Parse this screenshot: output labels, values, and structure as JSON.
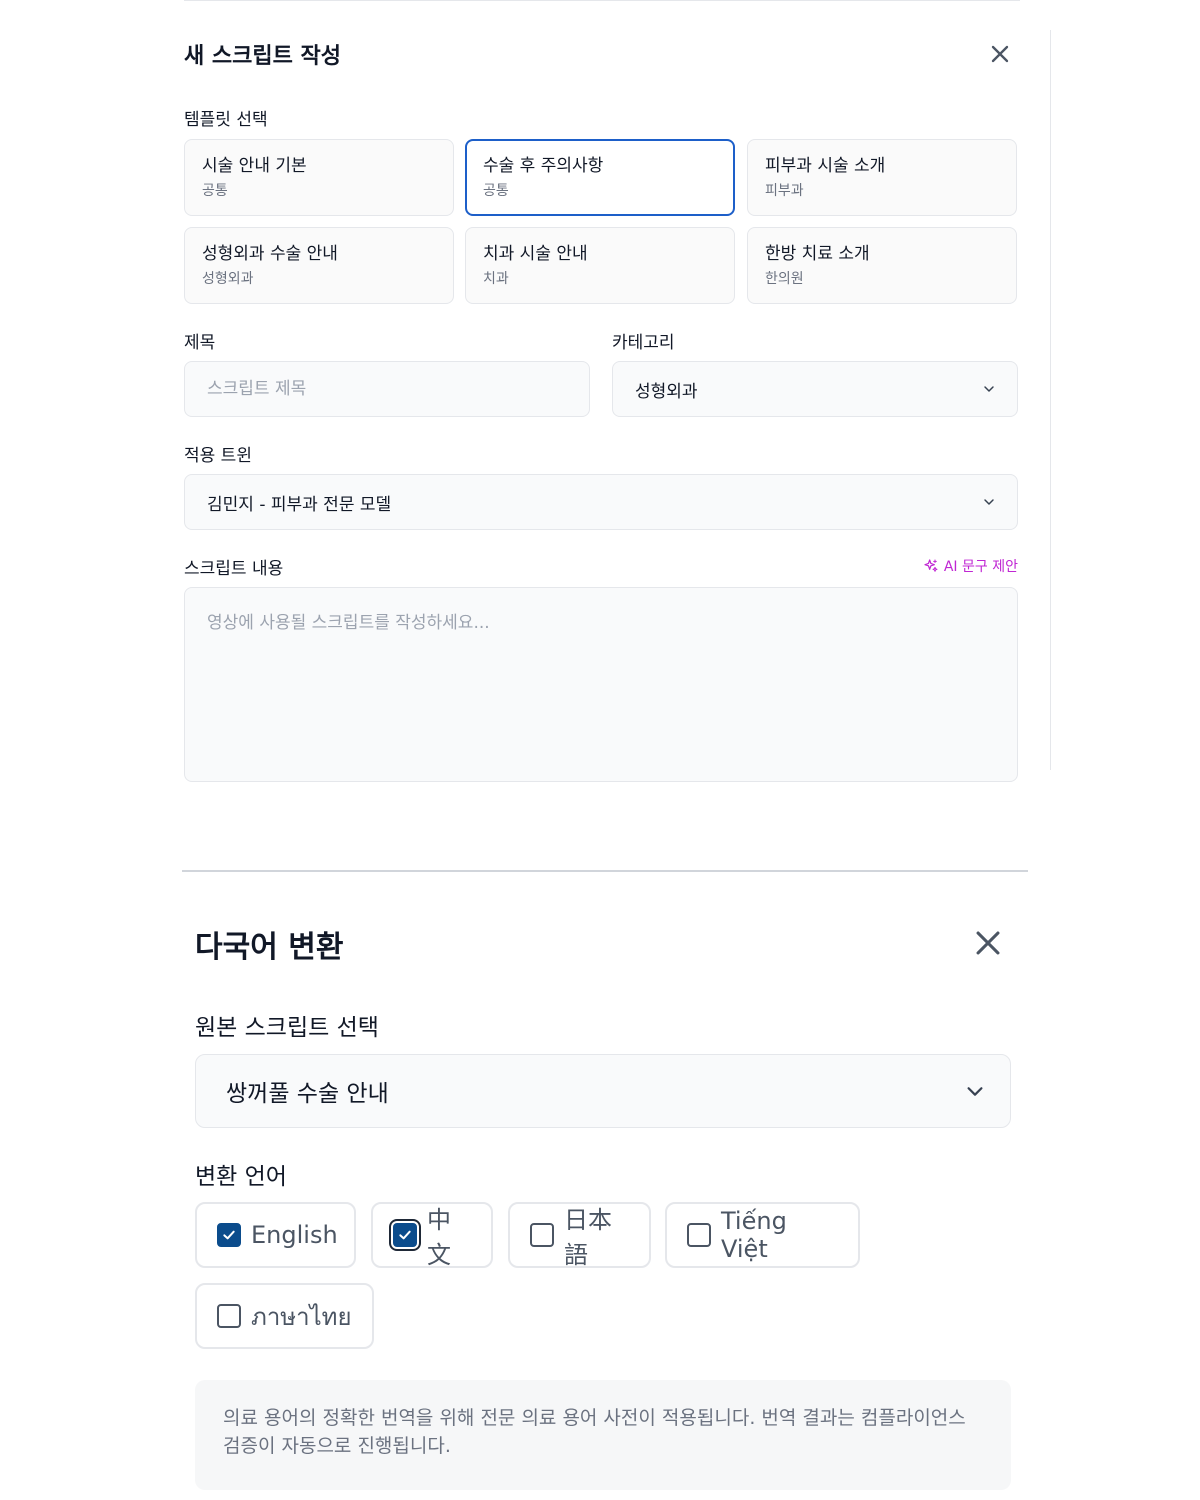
{
  "script_editor": {
    "title": "새 스크립트 작성",
    "close_icon": "close-icon",
    "template_label": "템플릿 선택",
    "templates": [
      {
        "name": "시술 안내 기본",
        "category": "공통",
        "selected": false
      },
      {
        "name": "수술 후 주의사항",
        "category": "공통",
        "selected": true
      },
      {
        "name": "피부과 시술 소개",
        "category": "피부과",
        "selected": false
      },
      {
        "name": "성형외과 수술 안내",
        "category": "성형외과",
        "selected": false
      },
      {
        "name": "치과 시술 안내",
        "category": "치과",
        "selected": false
      },
      {
        "name": "한방 치료 소개",
        "category": "한의원",
        "selected": false
      }
    ],
    "title_label": "제목",
    "title_placeholder": "스크립트 제목",
    "category_label": "카테고리",
    "category_value": "성형외과",
    "twin_label": "적용 트윈",
    "twin_value": "김민지 - 피부과 전문 모델",
    "content_label": "스크립트 내용",
    "ai_suggest": "AI 문구 제안",
    "ai_icon": "sparkles-icon",
    "content_placeholder": "영상에 사용될 스크립트를 작성하세요...",
    "accent": "#1d5fc9",
    "ai_color": "#c026d3"
  },
  "translation": {
    "title": "다국어 변환",
    "close_icon": "close-icon",
    "source_label": "원본 스크립트 선택",
    "source_value": "쌍꺼풀 수술 안내",
    "languages_label": "변환 언어",
    "languages": [
      {
        "label": "English",
        "checked": true
      },
      {
        "label": "中文",
        "checked": true
      },
      {
        "label": "日本語",
        "checked": false
      },
      {
        "label": "Tiếng Việt",
        "checked": false
      },
      {
        "label": "ภาษาไทย",
        "checked": false
      }
    ],
    "note": "의료 용어의 정확한 번역을 위해 전문 의료 용어 사전이 적용됩니다. 번역 결과는 컴플라이언스 검증이 자동으로 진행됩니다.",
    "checkbox_color": "#0b4c8c"
  }
}
